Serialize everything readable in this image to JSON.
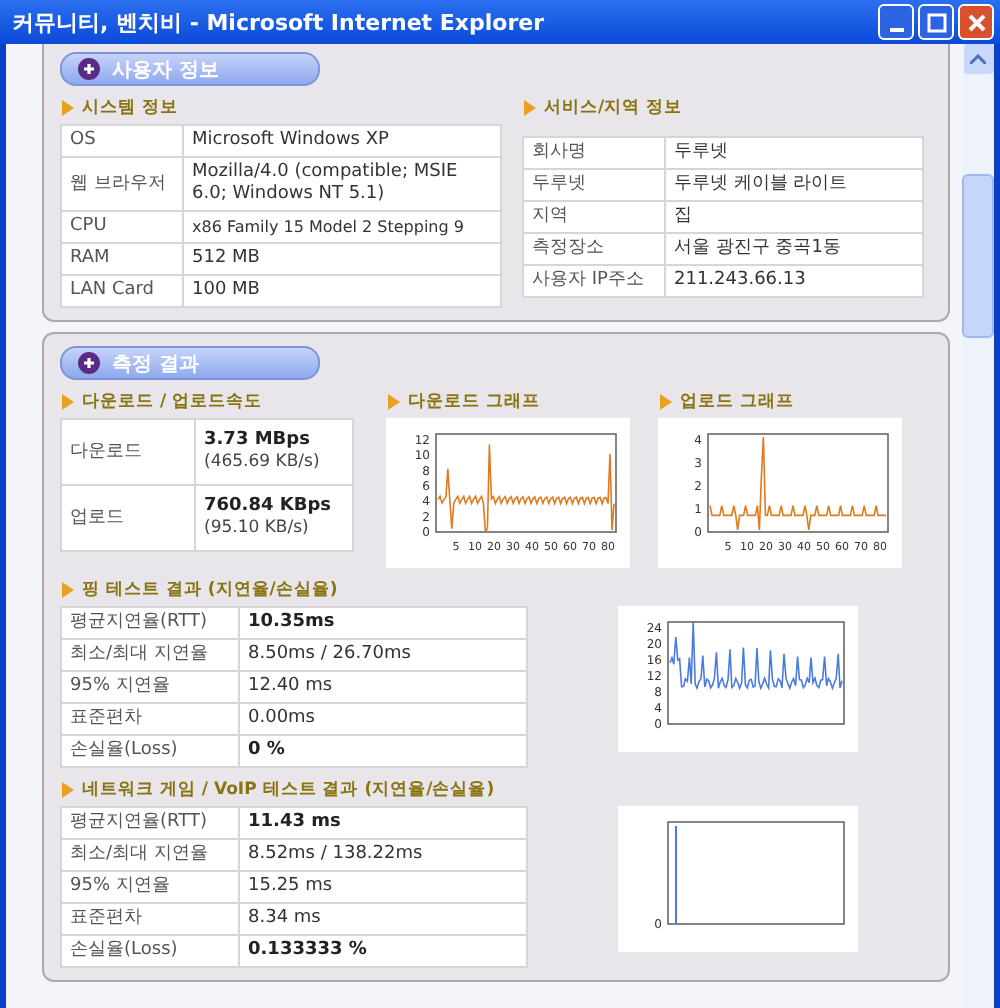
{
  "window": {
    "title": "커뮤니티, 벤치비 - Microsoft Internet Explorer"
  },
  "user_info": {
    "title": "사용자 정보",
    "system": {
      "heading": "시스템 정보",
      "rows": [
        {
          "label": "OS",
          "value": "Microsoft Windows XP"
        },
        {
          "label": "웹 브라우저",
          "value": "Mozilla/4.0 (compatible; MSIE 6.0; Windows NT 5.1)"
        },
        {
          "label": "CPU",
          "value": "x86 Family 15 Model 2 Stepping 9"
        },
        {
          "label": "RAM",
          "value": "512 MB"
        },
        {
          "label": "LAN Card",
          "value": "100 MB"
        }
      ]
    },
    "service": {
      "heading": "서비스/지역 정보",
      "rows": [
        {
          "label": "회사명",
          "value": "두루넷"
        },
        {
          "label": "두루넷",
          "value": "두루넷 케이블 라이트"
        },
        {
          "label": "지역",
          "value": "집"
        },
        {
          "label": "측정장소",
          "value": "서울 광진구 중곡1동"
        },
        {
          "label": "사용자 IP주소",
          "value": "211.243.66.13"
        }
      ]
    }
  },
  "results": {
    "title": "측정 결과",
    "speed": {
      "heading": "다운로드 / 업로드속도",
      "rows": [
        {
          "label": "다운로드",
          "value": "3.73 MBps",
          "detail": "(465.69 KB/s)"
        },
        {
          "label": "업로드",
          "value": "760.84 KBps",
          "detail": "(95.10 KB/s)"
        }
      ]
    },
    "download_graph": {
      "heading": "다운로드 그래프",
      "y_ticks": [
        "12",
        "10",
        "8",
        "6",
        "4",
        "2",
        "0"
      ],
      "x_ticks": [
        "5",
        "10",
        "20",
        "30",
        "40",
        "50",
        "60",
        "70",
        "80"
      ]
    },
    "upload_graph": {
      "heading": "업로드 그래프",
      "y_ticks": [
        "4",
        "3",
        "2",
        "1",
        "0"
      ],
      "x_ticks": [
        "5",
        "10",
        "20",
        "30",
        "40",
        "50",
        "60",
        "70",
        "80"
      ]
    },
    "ping": {
      "heading": "핑 테스트 결과 (지연율/손실율)",
      "rows": [
        {
          "label": "평균지연율(RTT)",
          "value": "10.35ms",
          "emphasis": true
        },
        {
          "label": "최소/최대 지연율",
          "value": "8.50ms / 26.70ms",
          "emphasis": false
        },
        {
          "label": "95% 지연율",
          "value": "12.40 ms",
          "emphasis": false
        },
        {
          "label": "표준편차",
          "value": "0.00ms",
          "emphasis": false
        },
        {
          "label": "손실율(Loss)",
          "value": "0 %",
          "emphasis": true
        }
      ]
    },
    "ping_graph": {
      "y_ticks": [
        "24",
        "20",
        "16",
        "12",
        "8",
        "4",
        "0"
      ]
    },
    "game": {
      "heading": "네트워크 게임 / VoIP 테스트 결과 (지연율/손실율)",
      "rows": [
        {
          "label": "평균지연율(RTT)",
          "value": "11.43 ms",
          "emphasis": true
        },
        {
          "label": "최소/최대 지연율",
          "value": "8.52ms / 138.22ms",
          "emphasis": false
        },
        {
          "label": "95% 지연율",
          "value": "15.25 ms",
          "emphasis": false
        },
        {
          "label": "표준편차",
          "value": "8.34 ms",
          "emphasis": false
        },
        {
          "label": "손실율(Loss)",
          "value": "0.133333 %",
          "emphasis": true
        }
      ]
    },
    "game_graph": {
      "y_ticks": [
        "0"
      ]
    }
  }
}
